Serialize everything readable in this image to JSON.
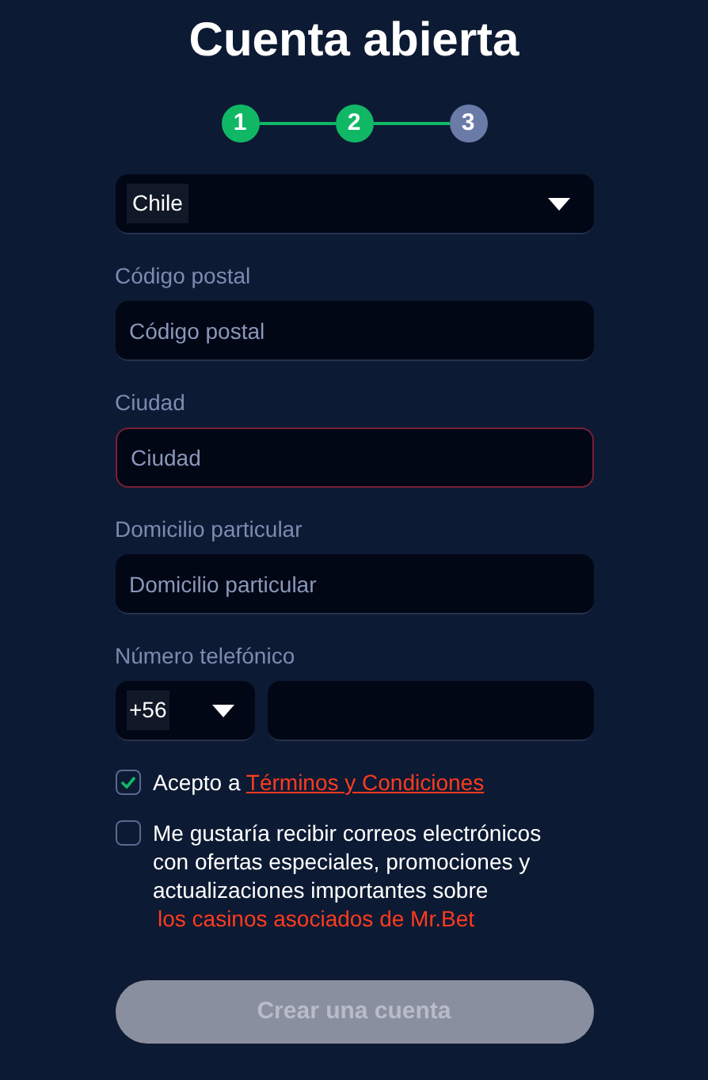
{
  "title": "Cuenta abierta",
  "steps": [
    {
      "label": "1",
      "done": true
    },
    {
      "label": "2",
      "done": true
    },
    {
      "label": "3",
      "done": false
    }
  ],
  "country_select": {
    "value": "Chile"
  },
  "fields": [
    {
      "label": "Código postal",
      "placeholder": "Código postal",
      "error": false
    },
    {
      "label": "Ciudad",
      "placeholder": "Ciudad",
      "error": true
    },
    {
      "label": "Domicilio particular",
      "placeholder": "Domicilio particular",
      "error": false
    }
  ],
  "phone": {
    "label": "Número telefónico",
    "code": "+56"
  },
  "consents": [
    {
      "text": "Acepto a",
      "link": "Términos y Condiciones",
      "checked": true,
      "kind": "inline"
    },
    {
      "text": "Me gustaría recibir correos electrónicos con ofertas especiales, promociones y actualizaciones importantes sobre",
      "link": "los casinos asociados de Mr.Bet",
      "checked": false,
      "kind": "block"
    }
  ],
  "submit": {
    "label": "Crear una cuenta",
    "disabled": true
  }
}
